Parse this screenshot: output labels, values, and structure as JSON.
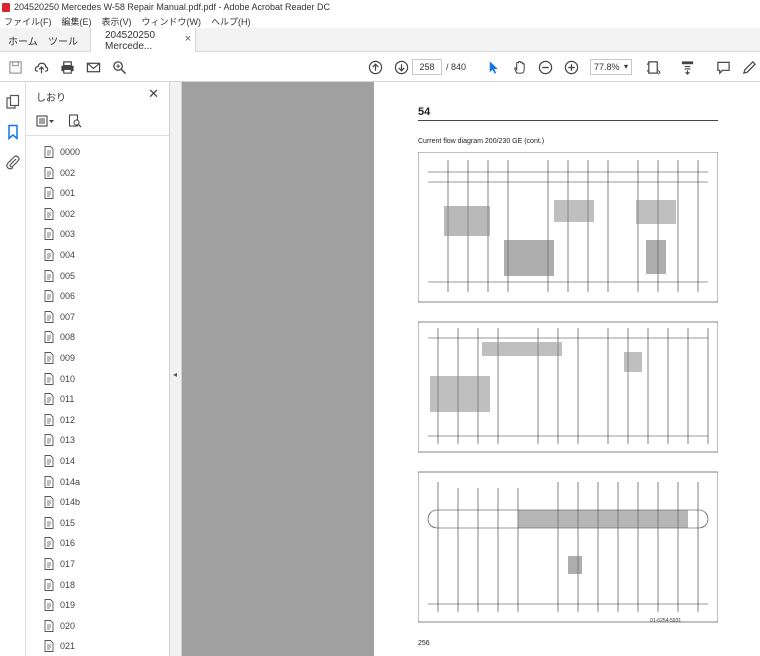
{
  "window": {
    "title": "204520250 Mercedes W-58 Repair Manual.pdf.pdf - Adobe Acrobat Reader DC"
  },
  "menu": [
    "ファイル(F)",
    "編集(E)",
    "表示(V)",
    "ウィンドウ(W)",
    "ヘルプ(H)"
  ],
  "tabs": {
    "home": "ホーム",
    "tools": "ツール",
    "document": "204520250 Mercede..."
  },
  "toolbar": {
    "page_current": "258",
    "page_total": "/ 840",
    "zoom": "77.8%",
    "icons": [
      "save-icon",
      "cloud-upload-icon",
      "print-icon",
      "email-icon",
      "zoom-search-icon",
      "page-up-icon",
      "page-down-icon",
      "select-cursor-icon",
      "hand-icon",
      "zoom-out-icon",
      "zoom-in-icon",
      "fit-page-icon",
      "scroll-mode-icon",
      "comment-icon",
      "pen-icon"
    ]
  },
  "rail_icons": [
    "pages-icon",
    "bookmark-icon",
    "attachment-icon"
  ],
  "bookmarks": {
    "title": "しおり",
    "items": [
      "0000",
      "002",
      "001",
      "002",
      "003",
      "004",
      "005",
      "006",
      "007",
      "008",
      "009",
      "010",
      "011",
      "012",
      "013",
      "014",
      "014a",
      "014b",
      "015",
      "016",
      "017",
      "018",
      "019",
      "020",
      "021"
    ]
  },
  "page": {
    "number": "54",
    "caption": "Current flow diagram 200/230 GE (cont.)",
    "footer": "256",
    "ref": "01-6254-5931"
  }
}
